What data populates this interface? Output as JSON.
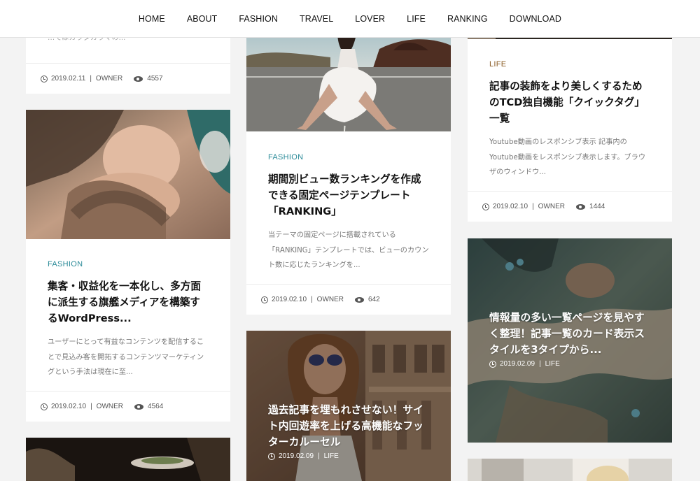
{
  "nav": [
    "HOME",
    "ABOUT",
    "FASHION",
    "TRAVEL",
    "LOVER",
    "LIFE",
    "RANKING",
    "DOWNLOAD"
  ],
  "col1": {
    "card1": {
      "excerpt_tail": "…てはカラダカラマの...",
      "date": "2019.02.11",
      "author": "OWNER",
      "views": "4557"
    },
    "card2": {
      "category": "FASHION",
      "title": "集客・収益化を一本化し、多方面に派生する旗艦メディアを構築するWordPress...",
      "excerpt": "ユーザーにとって有益なコンテンツを配信することで見込み客を開拓するコンテンツマーケティングという手法は現在に至...",
      "date": "2019.02.10",
      "author": "OWNER",
      "views": "4564"
    }
  },
  "col2": {
    "card1": {
      "category": "FASHION",
      "title": "期間別ビュー数ランキングを作成できる固定ページテンプレート「RANKING」",
      "excerpt": "当テーマの固定ページに搭載されている「RANKING」テンプレートでは、ビューのカウント数に応じたランキングを...",
      "date": "2019.02.10",
      "author": "OWNER",
      "views": "642"
    },
    "card2": {
      "title": "過去記事を埋もれさせない！サイト内回遊率を上げる高機能なフッターカルーセル",
      "date": "2019.02.09",
      "category": "LIFE"
    }
  },
  "col3": {
    "card1": {
      "category": "LIFE",
      "title": "記事の装飾をより美しくするためのTCD独自機能「クイックタグ」一覧",
      "excerpt": "Youtube動画のレスポンシブ表示 記事内のYoutube動画をレスポンシブ表示します。ブラウザのウィンドウ...",
      "date": "2019.02.10",
      "author": "OWNER",
      "views": "1444"
    },
    "card2": {
      "title": "情報量の多い一覧ページを見やすく整理！記事一覧のカード表示スタイルを3タイプから...",
      "date": "2019.02.09",
      "category": "LIFE"
    }
  },
  "colors": {
    "fashion": "#2a8a98",
    "life": "#8b5c24",
    "header_bg": "#ffffff",
    "page_bg": "#f3f3f3"
  }
}
